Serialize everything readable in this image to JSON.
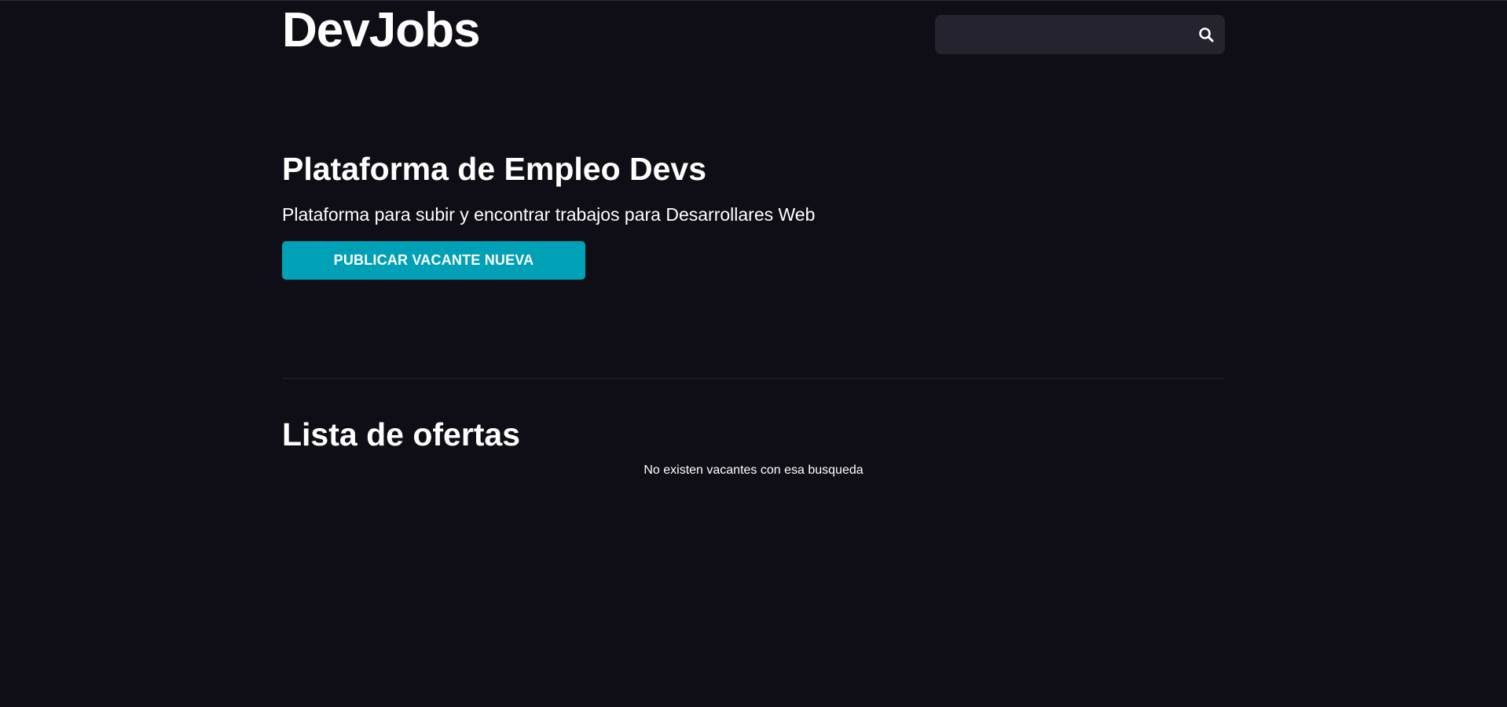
{
  "header": {
    "logo": "DevJobs",
    "search": {
      "placeholder": "",
      "value": "",
      "icon": "search-icon"
    }
  },
  "hero": {
    "title": "Plataforma de Empleo Devs",
    "subtitle": "Plataforma para subir y encontrar trabajos para Desarrollares Web",
    "cta_label": "PUBLICAR VACANTE NUEVA"
  },
  "offers": {
    "title": "Lista de ofertas",
    "empty_message": "No existen vacantes con esa busqueda"
  },
  "colors": {
    "background": "#0f0e17",
    "search_bg": "#24232e",
    "accent": "#00a1b7",
    "text": "#fffffe"
  }
}
